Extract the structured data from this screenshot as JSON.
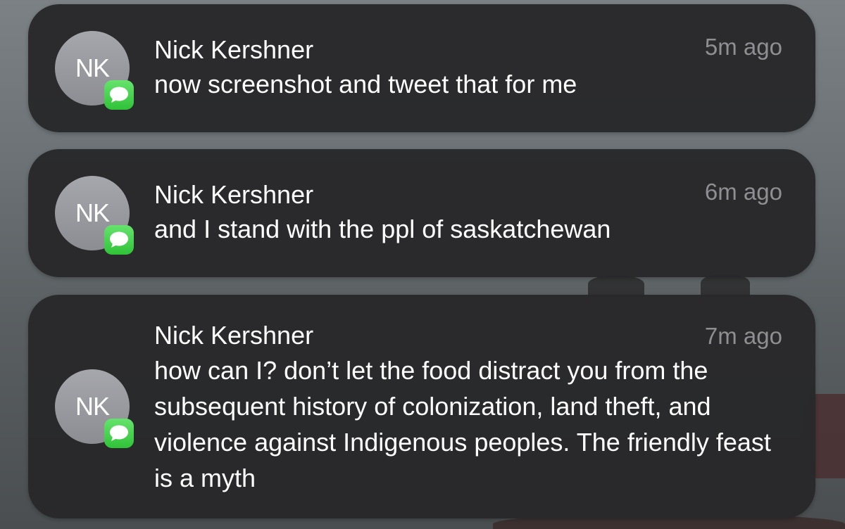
{
  "notifications": [
    {
      "initials": "NK",
      "sender": "Nick Kershner",
      "time": "5m ago",
      "message": "now screenshot and tweet that for me",
      "app_icon": "messages-icon"
    },
    {
      "initials": "NK",
      "sender": "Nick Kershner",
      "time": "6m ago",
      "message": "and I stand with the ppl of saskatchewan",
      "app_icon": "messages-icon"
    },
    {
      "initials": "NK",
      "sender": "Nick Kershner",
      "time": "7m ago",
      "message": "how can I? don’t let the food distract you from the subsequent history of colonization, land theft, and violence against Indigenous peoples. The friendly feast is a myth",
      "app_icon": "messages-icon"
    }
  ],
  "colors": {
    "card_background": "#28282A",
    "avatar": "#9A9BA1",
    "badge_green": "#34C759",
    "time_gray": "#8E8E93",
    "text": "#FFFFFF"
  }
}
